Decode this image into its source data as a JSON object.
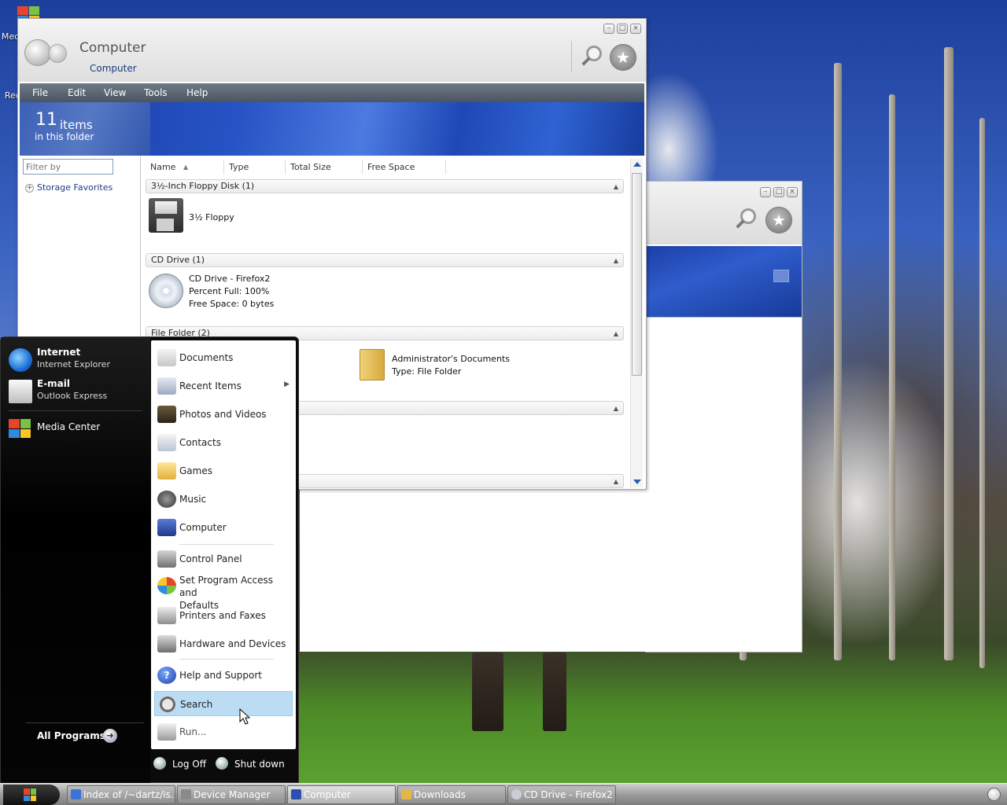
{
  "desktop": {
    "icon_labels": [
      "Med",
      "Rec"
    ]
  },
  "explorer": {
    "title": "Computer",
    "breadcrumb": "Computer",
    "menu": [
      "File",
      "Edit",
      "View",
      "Tools",
      "Help"
    ],
    "banner": {
      "count": "11",
      "count_unit": "items",
      "subtitle": "in this folder"
    },
    "filter_placeholder": "Filter by",
    "left_nav": [
      "Storage Favorites"
    ],
    "columns": [
      "Name",
      "Type",
      "Total Size",
      "Free Space"
    ],
    "sort_column": "Name",
    "groups": [
      {
        "label": "3½-Inch Floppy Disk (1)"
      },
      {
        "label": "CD Drive (1)"
      },
      {
        "label": "File Folder (2)"
      },
      {
        "label": ""
      },
      {
        "label": ""
      }
    ],
    "floppy": {
      "name": "3½ Floppy"
    },
    "cd": {
      "name": "CD Drive - Firefox2",
      "percent": "Percent Full: 100%",
      "free": "Free Space: 0 bytes"
    },
    "folder": {
      "name": "Administrator's Documents",
      "type": "Type: File Folder"
    }
  },
  "start_menu": {
    "pinned": [
      {
        "title": "Internet",
        "sub": "Internet Explorer",
        "icon": "internet-explorer-icon"
      },
      {
        "title": "E-mail",
        "sub": "Outlook Express",
        "icon": "outlook-express-icon"
      }
    ],
    "recent": [
      {
        "label": "Media Center",
        "icon": "media-center-icon"
      }
    ],
    "all_programs": "All Programs",
    "right_items": [
      {
        "label": "Documents",
        "icon": "documents-icon"
      },
      {
        "label": "Recent Items",
        "icon": "recent-items-icon"
      },
      {
        "label": "Photos and Videos",
        "icon": "photos-icon"
      },
      {
        "label": "Contacts",
        "icon": "contacts-icon"
      },
      {
        "label": "Games",
        "icon": "games-icon"
      },
      {
        "label": "Music",
        "icon": "music-icon"
      },
      {
        "label": "Computer",
        "icon": "computer-icon"
      },
      {
        "label": "Control Panel",
        "icon": "control-panel-icon"
      },
      {
        "label": "Set Program Access and",
        "label2": "Defaults",
        "icon": "program-access-icon"
      },
      {
        "label": "Printers and Faxes",
        "icon": "printer-icon"
      },
      {
        "label": "Hardware and Devices",
        "icon": "hardware-icon"
      },
      {
        "label": "Help and Support",
        "icon": "help-icon"
      },
      {
        "label": "Search",
        "icon": "search-icon"
      },
      {
        "label": "Run...",
        "icon": "run-icon"
      }
    ],
    "selected_item": "Search",
    "log_off": "Log Off",
    "shut_down": "Shut down"
  },
  "taskbar": {
    "tasks": [
      {
        "label": "Index of /~dartz/is...",
        "active": false
      },
      {
        "label": "Device Manager",
        "active": false
      },
      {
        "label": "Computer",
        "active": true
      },
      {
        "label": "Downloads",
        "active": false
      },
      {
        "label": "CD Drive - Firefox2",
        "active": false
      }
    ]
  },
  "colors": {
    "menubar": "#4b5561",
    "banner": "#2654c4",
    "selection": "#bcdcf3",
    "start_menu_bg": "#0b0b0b"
  }
}
